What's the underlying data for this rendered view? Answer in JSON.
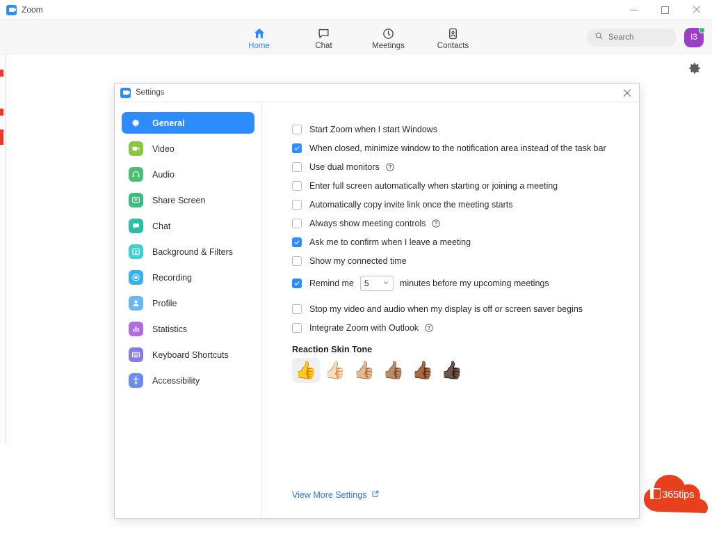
{
  "window": {
    "title": "Zoom",
    "logo_icon": "zoom-logo-icon",
    "controls": {
      "minimize": "minimize-icon",
      "maximize": "maximize-icon",
      "close": "close-icon"
    }
  },
  "navbar": {
    "items": [
      {
        "label": "Home",
        "icon": "home-icon",
        "active": true
      },
      {
        "label": "Chat",
        "icon": "chat-bubble-icon",
        "active": false
      },
      {
        "label": "Meetings",
        "icon": "clock-icon",
        "active": false
      },
      {
        "label": "Contacts",
        "icon": "contact-card-icon",
        "active": false
      }
    ],
    "search": {
      "placeholder": "Search",
      "icon": "search-icon"
    },
    "avatar": {
      "initials": "I3",
      "color": "#9b3fc4",
      "status": "available",
      "status_color": "#22c55e"
    },
    "accent_color": "#2d8cff"
  },
  "page_gear": {
    "icon": "gear-icon"
  },
  "settings_dialog": {
    "title": "Settings",
    "logo_icon": "zoom-logo-icon",
    "close_icon": "close-icon",
    "sidebar": [
      {
        "label": "General",
        "icon": "gear-icon",
        "color": "#2d8cff",
        "active": true
      },
      {
        "label": "Video",
        "icon": "video-camera-icon",
        "color": "#8cc63f",
        "active": false
      },
      {
        "label": "Audio",
        "icon": "headphones-icon",
        "color": "#4bbf73",
        "active": false
      },
      {
        "label": "Share Screen",
        "icon": "share-screen-icon",
        "color": "#3dbd7d",
        "active": false
      },
      {
        "label": "Chat",
        "icon": "chat-bubble-icon",
        "color": "#2bc0a4",
        "active": false
      },
      {
        "label": "Background & Filters",
        "icon": "background-filters-icon",
        "color": "#3fd0d4",
        "active": false
      },
      {
        "label": "Recording",
        "icon": "record-icon",
        "color": "#35b2ef",
        "active": false
      },
      {
        "label": "Profile",
        "icon": "person-icon",
        "color": "#6ab8f2",
        "active": false
      },
      {
        "label": "Statistics",
        "icon": "bar-chart-icon",
        "color": "#b36be0",
        "active": false
      },
      {
        "label": "Keyboard Shortcuts",
        "icon": "keyboard-icon",
        "color": "#8a7ae8",
        "active": false
      },
      {
        "label": "Accessibility",
        "icon": "accessibility-icon",
        "color": "#6d8cf0",
        "active": false
      }
    ],
    "options": [
      {
        "label": "Start Zoom when I start Windows",
        "checked": false,
        "help": false
      },
      {
        "label": "When closed, minimize window to the notification area instead of the task bar",
        "checked": true,
        "help": false
      },
      {
        "label": "Use dual monitors",
        "checked": false,
        "help": true
      },
      {
        "label": "Enter full screen automatically when starting or joining a meeting",
        "checked": false,
        "help": false
      },
      {
        "label": "Automatically copy invite link once the meeting starts",
        "checked": false,
        "help": false
      },
      {
        "label": "Always show meeting controls",
        "checked": false,
        "help": true
      },
      {
        "label": "Ask me to confirm when I leave a meeting",
        "checked": true,
        "help": false
      },
      {
        "label": "Show my connected time",
        "checked": false,
        "help": false
      }
    ],
    "remind": {
      "checked": true,
      "prefix": "Remind me",
      "value": "5",
      "options": [
        "5"
      ],
      "suffix": "minutes before my upcoming meetings",
      "chevron_icon": "chevron-down-icon"
    },
    "options_after": [
      {
        "label": "Stop my video and audio when my display is off or screen saver begins",
        "checked": false,
        "help": false
      },
      {
        "label": "Integrate Zoom with Outlook",
        "checked": false,
        "help": true
      }
    ],
    "skin_tone": {
      "heading": "Reaction Skin Tone",
      "tones": [
        {
          "glyph": "👍",
          "name": "thumbs-up-default",
          "selected": true
        },
        {
          "glyph": "👍🏻",
          "name": "thumbs-up-light",
          "selected": false
        },
        {
          "glyph": "👍🏼",
          "name": "thumbs-up-medium-light",
          "selected": false
        },
        {
          "glyph": "👍🏽",
          "name": "thumbs-up-medium",
          "selected": false
        },
        {
          "glyph": "👍🏾",
          "name": "thumbs-up-medium-dark",
          "selected": false
        },
        {
          "glyph": "👍🏿",
          "name": "thumbs-up-dark",
          "selected": false
        }
      ]
    },
    "more_settings": {
      "label": "View More Settings",
      "icon": "external-link-icon",
      "color": "#2d75d6"
    }
  },
  "watermark": {
    "text": "365tips",
    "color": "#e8401c",
    "icon": "office-icon"
  }
}
